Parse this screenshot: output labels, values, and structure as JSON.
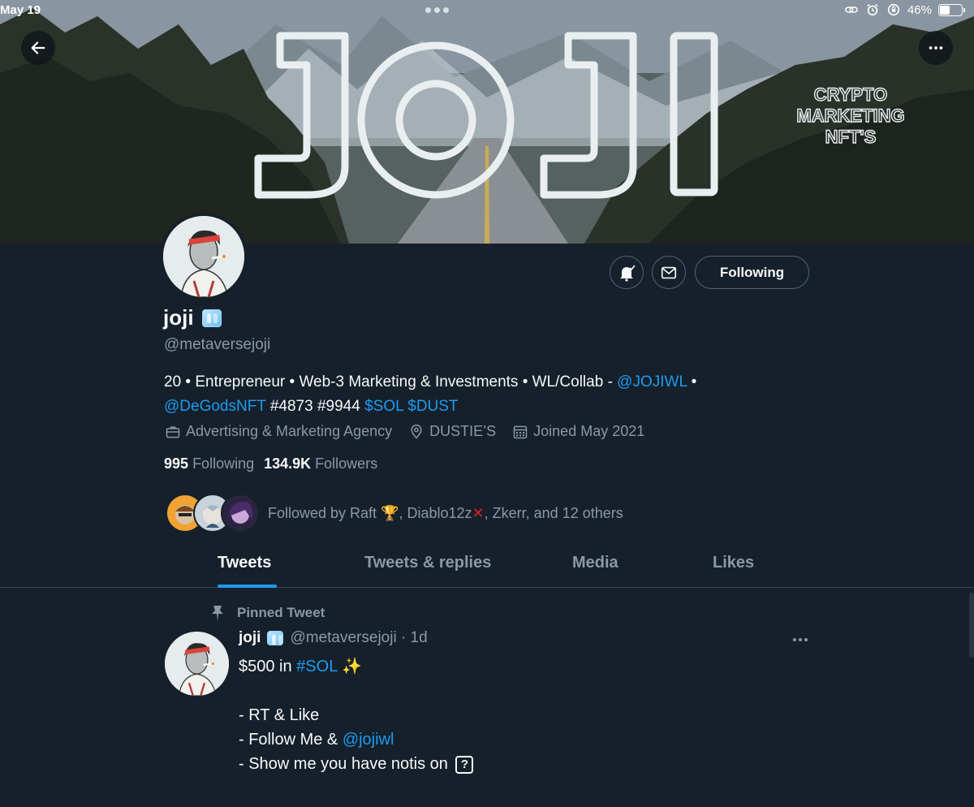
{
  "status_bar": {
    "time": "May 19",
    "battery": "46%",
    "battery_level": 0.46
  },
  "banner": {
    "title": "JOJI",
    "side_text_line1": "CRYPTO",
    "side_text_line2": "MARKETING",
    "side_text_line3": "NFT'S"
  },
  "nav": {
    "back_icon": "arrow-left-icon",
    "more_icon": "more-horizontal-icon"
  },
  "profile": {
    "name": "joji",
    "handle": "@metaversejoji",
    "bio_line1_text": "20 • Entrepreneur • Web-3 Marketing & Investments • WL/Collab - ",
    "bio_line1_mention": "@JOJIWL",
    "bio_line1_end": " •",
    "bio_line2_mention": "@DeGodsNFT",
    "bio_line2_text": " #4873 #9944 ",
    "bio_line2_cashtags": "$SOL $DUST",
    "category": "Advertising & Marketing Agency",
    "location": "DUSTIE’S",
    "joined": "Joined May 2021",
    "following_count": "995",
    "following_label": "Following",
    "followers_count": "134.9K",
    "followers_label": "Followers",
    "followed_by_prefix": "Followed by Raft ",
    "followed_by_mid": ", Diablo12z",
    "followed_by_suffix": ", Zkerr, and 12 others"
  },
  "actions": {
    "following_button": "Following"
  },
  "tabs": [
    {
      "label": "Tweets",
      "active": true
    },
    {
      "label": "Tweets & replies",
      "active": false
    },
    {
      "label": "Media",
      "active": false
    },
    {
      "label": "Likes",
      "active": false
    }
  ],
  "tweet": {
    "pinned_label": "Pinned Tweet",
    "name": "joji",
    "handle_time": "@metaversejoji · 1d",
    "line1_prefix": "$500 in ",
    "line1_hashtag": "#SOL",
    "line2": "- RT & Like",
    "line3_prefix": "- Follow Me & ",
    "line3_mention": "@jojiwl",
    "line4": "- Show me you have notis on",
    "line4_box": "?"
  },
  "colors": {
    "background": "#15202b",
    "accent": "#1d9bf0",
    "muted": "#8b98a5",
    "border": "#38444d"
  }
}
